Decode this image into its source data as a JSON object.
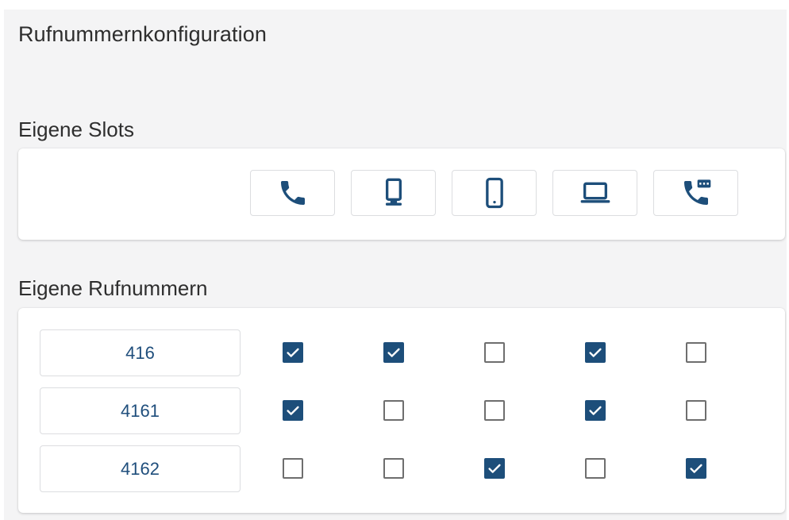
{
  "page": {
    "title": "Rufnummernkonfiguration"
  },
  "slots_section": {
    "title": "Eigene Slots",
    "slots": [
      {
        "icon": "phone-icon"
      },
      {
        "icon": "desk-phone-icon"
      },
      {
        "icon": "mobile-icon"
      },
      {
        "icon": "laptop-icon"
      },
      {
        "icon": "sip-phone-icon"
      }
    ]
  },
  "numbers_section": {
    "title": "Eigene Rufnummern",
    "rows": [
      {
        "number": "416",
        "checks": [
          true,
          true,
          false,
          true,
          false
        ]
      },
      {
        "number": "4161",
        "checks": [
          true,
          false,
          false,
          true,
          false
        ]
      },
      {
        "number": "4162",
        "checks": [
          false,
          false,
          true,
          false,
          true
        ]
      }
    ]
  },
  "colors": {
    "accent": "#1d4e7a",
    "number_text": "#1f4e7c",
    "background": "#f4f4f5"
  }
}
